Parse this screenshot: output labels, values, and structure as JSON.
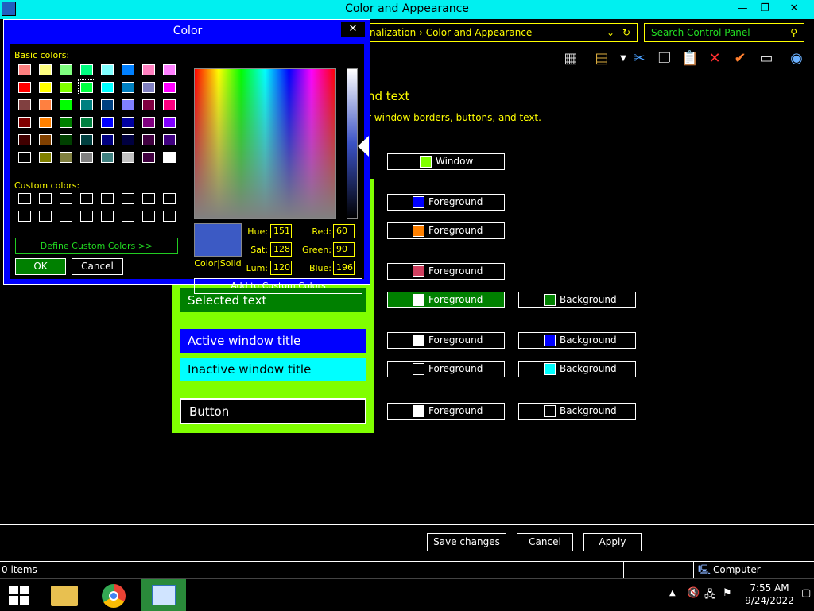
{
  "window": {
    "title": "Color and Appearance",
    "min": "—",
    "max": "❐",
    "close": "✕"
  },
  "address": {
    "path": "nalization  ›  Color and Appearance",
    "search_placeholder": "Search Control Panel"
  },
  "page": {
    "heading": "nd text",
    "subheading": "r window borders, buttons, and text."
  },
  "preview": {
    "selected_text": "Selected text",
    "active_title": "Active window title",
    "inactive_title": "Inactive window title",
    "button": "Button"
  },
  "swatches": [
    {
      "label": "Window",
      "color": "#80ff00"
    },
    {
      "label": "Foreground",
      "color": "#0000ff"
    },
    {
      "label": "Foreground",
      "color": "#ff8000"
    },
    {
      "label": "Foreground",
      "color": "#d04060"
    },
    {
      "label": "Foreground",
      "color": "#ffffff"
    },
    {
      "label": "Background",
      "color": "#008000"
    },
    {
      "label": "Foreground",
      "color": "#ffffff"
    },
    {
      "label": "Background",
      "color": "#0000ff"
    },
    {
      "label": "Foreground",
      "color": "#000000"
    },
    {
      "label": "Background",
      "color": "#00ffff"
    },
    {
      "label": "Foreground",
      "color": "#ffffff"
    },
    {
      "label": "Background",
      "color": "#000000"
    }
  ],
  "actions": {
    "save": "Save changes",
    "cancel": "Cancel",
    "apply": "Apply"
  },
  "status": {
    "items": "0 items",
    "location": "Computer"
  },
  "tray": {
    "time": "7:55 AM",
    "date": "9/24/2022"
  },
  "dialog": {
    "title": "Color",
    "close": "✕",
    "basic_colors_label": "Basic colors:",
    "custom_colors_label": "Custom colors:",
    "define_custom": "Define Custom Colors >>",
    "ok": "OK",
    "cancel": "Cancel",
    "color_solid": "Color|Solid",
    "add_custom": "Add to Custom Colors",
    "hue_label": "Hue:",
    "hue": "151",
    "sat_label": "Sat:",
    "sat": "128",
    "lum_label": "Lum:",
    "lum": "120",
    "red_label": "Red:",
    "red": "60",
    "green_label": "Green:",
    "green": "90",
    "blue_label": "Blue:",
    "blue": "196",
    "selected_color": "#3c5ac4",
    "basic_colors": [
      [
        "#ff8080",
        "#ffff80",
        "#80ff80",
        "#00ff80",
        "#80ffff",
        "#0080ff",
        "#ff80c0",
        "#ff80ff"
      ],
      [
        "#ff0000",
        "#ffff00",
        "#80ff00",
        "#00ff40",
        "#00ffff",
        "#0080c0",
        "#8080c0",
        "#ff00ff"
      ],
      [
        "#804040",
        "#ff8040",
        "#00ff00",
        "#008080",
        "#004080",
        "#8080ff",
        "#800040",
        "#ff0080"
      ],
      [
        "#800000",
        "#ff8000",
        "#008000",
        "#008040",
        "#0000ff",
        "#0000a0",
        "#800080",
        "#8000ff"
      ],
      [
        "#400000",
        "#804000",
        "#004000",
        "#004040",
        "#000080",
        "#000040",
        "#400040",
        "#400080"
      ],
      [
        "#000000",
        "#808000",
        "#808040",
        "#808080",
        "#408080",
        "#c0c0c0",
        "#400040",
        "#ffffff"
      ]
    ]
  }
}
